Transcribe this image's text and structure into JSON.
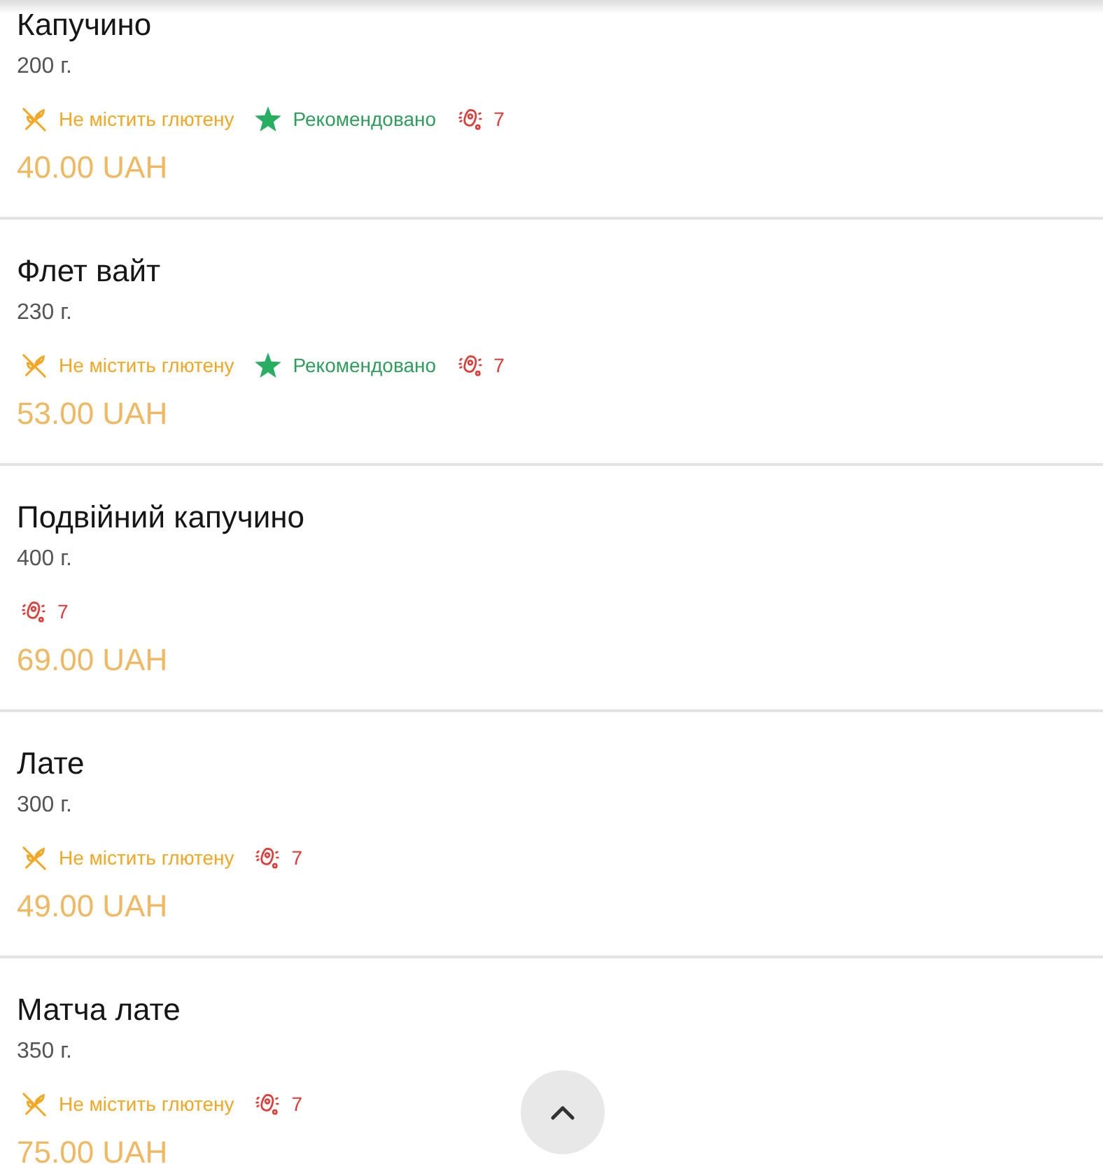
{
  "items": [
    {
      "name": "Капучино",
      "weight": "200 г.",
      "tags": [
        {
          "kind": "gluten_free",
          "label": "Не містить глютену"
        },
        {
          "kind": "recommended",
          "label": "Рекомендовано"
        },
        {
          "kind": "allergens",
          "label": "7"
        }
      ],
      "price": "40.00 UAH"
    },
    {
      "name": "Флет вайт",
      "weight": "230 г.",
      "tags": [
        {
          "kind": "gluten_free",
          "label": "Не містить глютену"
        },
        {
          "kind": "recommended",
          "label": "Рекомендовано"
        },
        {
          "kind": "allergens",
          "label": "7"
        }
      ],
      "price": "53.00 UAH"
    },
    {
      "name": "Подвійний капучино",
      "weight": "400 г.",
      "tags": [
        {
          "kind": "allergens",
          "label": "7"
        }
      ],
      "price": "69.00 UAH"
    },
    {
      "name": "Лате",
      "weight": "300 г.",
      "tags": [
        {
          "kind": "gluten_free",
          "label": "Не містить глютену"
        },
        {
          "kind": "allergens",
          "label": "7"
        }
      ],
      "price": "49.00 UAH"
    },
    {
      "name": "Матча лате",
      "weight": "350 г.",
      "tags": [
        {
          "kind": "gluten_free",
          "label": "Не містить глютену"
        },
        {
          "kind": "allergens",
          "label": "7"
        }
      ],
      "price": "75.00 UAH"
    }
  ]
}
